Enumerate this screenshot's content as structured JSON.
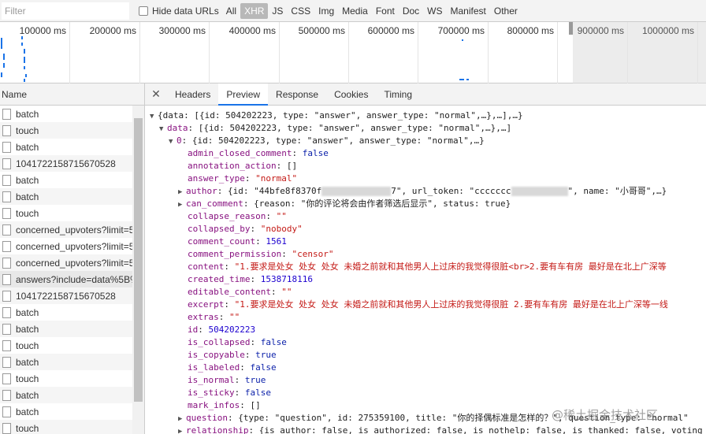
{
  "filter": {
    "placeholder": "Filter",
    "hide_urls_label": "Hide data URLs"
  },
  "types": [
    "All",
    "XHR",
    "JS",
    "CSS",
    "Img",
    "Media",
    "Font",
    "Doc",
    "WS",
    "Manifest",
    "Other"
  ],
  "active_type": "XHR",
  "timeline_ticks": [
    "100000 ms",
    "200000 ms",
    "300000 ms",
    "400000 ms",
    "500000 ms",
    "600000 ms",
    "700000 ms",
    "800000 ms",
    "900000 ms",
    "1000000 ms"
  ],
  "list_header": "Name",
  "requests": [
    "batch",
    "touch",
    "batch",
    "1041722158715670528",
    "batch",
    "batch",
    "touch",
    "concerned_upvoters?limit=5",
    "concerned_upvoters?limit=5",
    "concerned_upvoters?limit=5",
    "answers?include=data%5B%2A%5D",
    "1041722158715670528",
    "batch",
    "batch",
    "touch",
    "batch",
    "touch",
    "batch",
    "batch",
    "touch",
    "batch"
  ],
  "selected_request_index": 10,
  "tabs": [
    "Headers",
    "Preview",
    "Response",
    "Cookies",
    "Timing"
  ],
  "active_tab": "Preview",
  "preview": {
    "l0": "{data: [{id: 504202223, type: \"answer\", answer_type: \"normal\",…},…],…}",
    "l1": "data: [{id: 504202223, type: \"answer\", answer_type: \"normal\",…},…]",
    "l2": "0: {id: 504202223, type: \"answer\", answer_type: \"normal\",…}",
    "fields": [
      {
        "key": "admin_closed_comment",
        "value": "false",
        "kind": "b"
      },
      {
        "key": "annotation_action",
        "value": "[]",
        "kind": "p"
      },
      {
        "key": "answer_type",
        "value": "\"normal\"",
        "kind": "s"
      },
      {
        "key": "author",
        "value": "{id: \"44bfe8f8370f",
        "value2": "7\", url_token: \"ccccccc",
        "value3": "\", name: \"小哥哥\",…}",
        "kind": "obj"
      },
      {
        "key": "can_comment",
        "value": "{reason: \"你的评论将会由作者筛选后显示\", status: true}",
        "kind": "objplain"
      },
      {
        "key": "collapse_reason",
        "value": "\"\"",
        "kind": "s"
      },
      {
        "key": "collapsed_by",
        "value": "\"nobody\"",
        "kind": "s"
      },
      {
        "key": "comment_count",
        "value": "1561",
        "kind": "n"
      },
      {
        "key": "comment_permission",
        "value": "\"censor\"",
        "kind": "s"
      },
      {
        "key": "content",
        "value": "\"1.要求是处女 处女 处女 未婚之前就和其他男人上过床的我觉得很脏<br>2.要有车有房 最好是在北上广深等",
        "kind": "s"
      },
      {
        "key": "created_time",
        "value": "1538718116",
        "kind": "n"
      },
      {
        "key": "editable_content",
        "value": "\"\"",
        "kind": "s"
      },
      {
        "key": "excerpt",
        "value": "\"1.要求是处女 处女 处女 未婚之前就和其他男人上过床的我觉得很脏 2.要有车有房 最好是在北上广深等一线",
        "kind": "s"
      },
      {
        "key": "extras",
        "value": "\"\"",
        "kind": "s"
      },
      {
        "key": "id",
        "value": "504202223",
        "kind": "n"
      },
      {
        "key": "is_collapsed",
        "value": "false",
        "kind": "b"
      },
      {
        "key": "is_copyable",
        "value": "true",
        "kind": "b"
      },
      {
        "key": "is_labeled",
        "value": "false",
        "kind": "b"
      },
      {
        "key": "is_normal",
        "value": "true",
        "kind": "b"
      },
      {
        "key": "is_sticky",
        "value": "false",
        "kind": "b"
      },
      {
        "key": "mark_infos",
        "value": "[]",
        "kind": "p"
      },
      {
        "key": "question",
        "value": "{type: \"question\", id: 275359100, title: \"你的择偶标准是怎样的？\", question_type: \"normal\"",
        "kind": "objplain"
      },
      {
        "key": "relationship",
        "value": "{is_author: false, is_authorized: false, is_nothelp: false, is_thanked: false, voting",
        "kind": "objplain"
      }
    ]
  },
  "watermark": "@稀土掘金技术社区"
}
